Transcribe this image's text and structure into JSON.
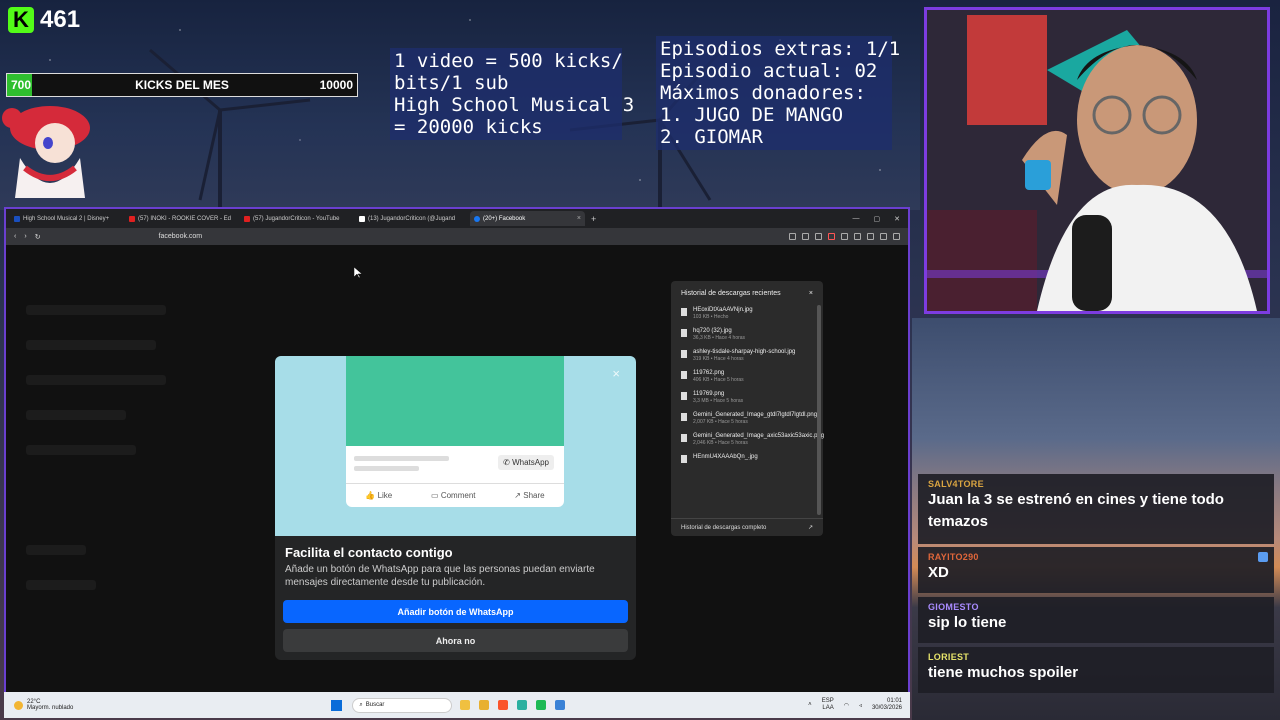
{
  "overlay": {
    "kick_count": "461",
    "kick_logo": "K",
    "goal": {
      "min": "700",
      "title": "KICKS DEL MES",
      "max": "10000",
      "progress_fraction": 0.07
    },
    "promo_lines": [
      "1 video = 500 kicks/",
      "bits/1 sub",
      "High School Musical 3",
      "= 20000 kicks"
    ],
    "episode_lines": [
      "Episodios extras: 1/1",
      "Episodio actual: 02",
      "Máximos donadores:",
      "1. JUGO DE MANGO",
      "2. GIOMAR"
    ]
  },
  "browser": {
    "tabs": [
      {
        "label": "High School Musical 2 | Disney+",
        "icon_color": "#1a4fbf",
        "active": false
      },
      {
        "label": "(57) INOKI - ROOKIE COVER - Ed",
        "icon_color": "#e02020",
        "active": false
      },
      {
        "label": "(57) JugandorCriticon - YouTube",
        "icon_color": "#e02020",
        "active": false
      },
      {
        "label": "(13) JugandorCriticon (@Jugand",
        "icon_color": "#ffffff",
        "active": false
      },
      {
        "label": "(20+) Facebook",
        "icon_color": "#1877f2",
        "active": true
      }
    ],
    "new_tab": "+",
    "url": "facebook.com"
  },
  "modal": {
    "close": "×",
    "title": "Facilita el contacto contigo",
    "description": "Añade un botón de WhatsApp para que las personas puedan enviarte mensajes directamente desde tu publicación.",
    "mock": {
      "whatsapp_label": "WhatsApp",
      "like": "Like",
      "comment": "Comment",
      "share": "Share"
    },
    "primary_button": "Añadir botón de WhatsApp",
    "secondary_button": "Ahora no"
  },
  "downloads": {
    "title": "Historial de descargas recientes",
    "close": "×",
    "items": [
      {
        "name": "HEoxiDtXaAAVNjn.jpg",
        "meta": "103 KB • Hecho"
      },
      {
        "name": "hq720 (32).jpg",
        "meta": "36,3 KB • Hace 4 horas"
      },
      {
        "name": "ashley-tisdale-sharpay-high-school.jpg",
        "meta": "319 KB • Hace 4 horas"
      },
      {
        "name": "119762.png",
        "meta": "406 KB • Hace 5 horas"
      },
      {
        "name": "119769.png",
        "meta": "3,3 MB • Hace 5 horas"
      },
      {
        "name": "Gemini_Generated_Image_gtdl7lgtdl7lgtdl.png",
        "meta": "2,007 KB • Hace 5 horas"
      },
      {
        "name": "Gemini_Generated_Image_axic53axic53axic.png",
        "meta": "2,046 KB • Hace 5 horas"
      },
      {
        "name": "HEnmU4XAAAbQn_.jpg",
        "meta": ""
      }
    ],
    "footer": "Historial de descargas completo"
  },
  "taskbar": {
    "temperature": "22°C",
    "weather": "Mayorm. nublado",
    "search": "Buscar",
    "lang": "ESP",
    "lang2": "LAA",
    "time": "01:01",
    "date": "30/03/2026"
  },
  "chat": [
    {
      "user": "SALV4TORE",
      "color": "#d9a441",
      "text": "Juan la 3 se estrenó en cines y tiene todo temazos"
    },
    {
      "user": "RAYITO290",
      "color": "#e0663a",
      "text": "XD"
    },
    {
      "user": "GIOMESTO",
      "color": "#a98bff",
      "text": "sip lo tiene"
    },
    {
      "user": "LORIEST",
      "color": "#e6e36a",
      "text": "tiene muchos spoiler"
    }
  ]
}
